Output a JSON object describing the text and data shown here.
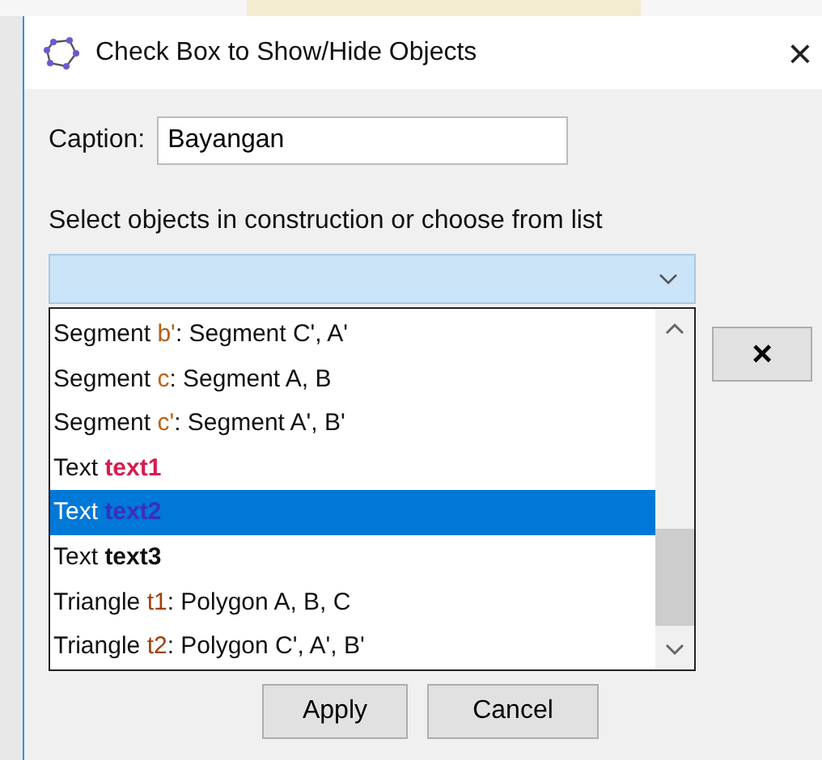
{
  "window": {
    "title": "Check Box to Show/Hide Objects",
    "close": "×"
  },
  "caption": {
    "label": "Caption:",
    "value": "Bayangan"
  },
  "select_label": "Select objects in construction or choose from list",
  "list": [
    {
      "prefix": "Segment ",
      "name": "b'",
      "suffix": ": Segment C', A'",
      "color": "#b0601a",
      "bold": false,
      "selected": false
    },
    {
      "prefix": "Segment ",
      "name": "c",
      "suffix": ": Segment A, B",
      "color": "#c06010",
      "bold": false,
      "selected": false
    },
    {
      "prefix": "Segment ",
      "name": "c'",
      "suffix": ": Segment A', B'",
      "color": "#c06010",
      "bold": false,
      "selected": false
    },
    {
      "prefix": "Text ",
      "name": "text1",
      "color": "#d81b50",
      "bold": true,
      "selected": false
    },
    {
      "prefix": "Text ",
      "name": "text2",
      "color": "#3a2ec0",
      "bold": true,
      "selected": true
    },
    {
      "prefix": "Text ",
      "name": "text3",
      "color": "#111111",
      "bold": true,
      "selected": false
    },
    {
      "prefix": "Triangle ",
      "name": "t1",
      "suffix": ": Polygon A, B, C",
      "color": "#a0400a",
      "bold": false,
      "selected": false
    },
    {
      "prefix": "Triangle ",
      "name": "t2",
      "suffix": ": Polygon C', A', B'",
      "color": "#a0400a",
      "bold": false,
      "selected": false
    }
  ],
  "remove_button": "×",
  "buttons": [
    "Apply",
    "Cancel"
  ]
}
